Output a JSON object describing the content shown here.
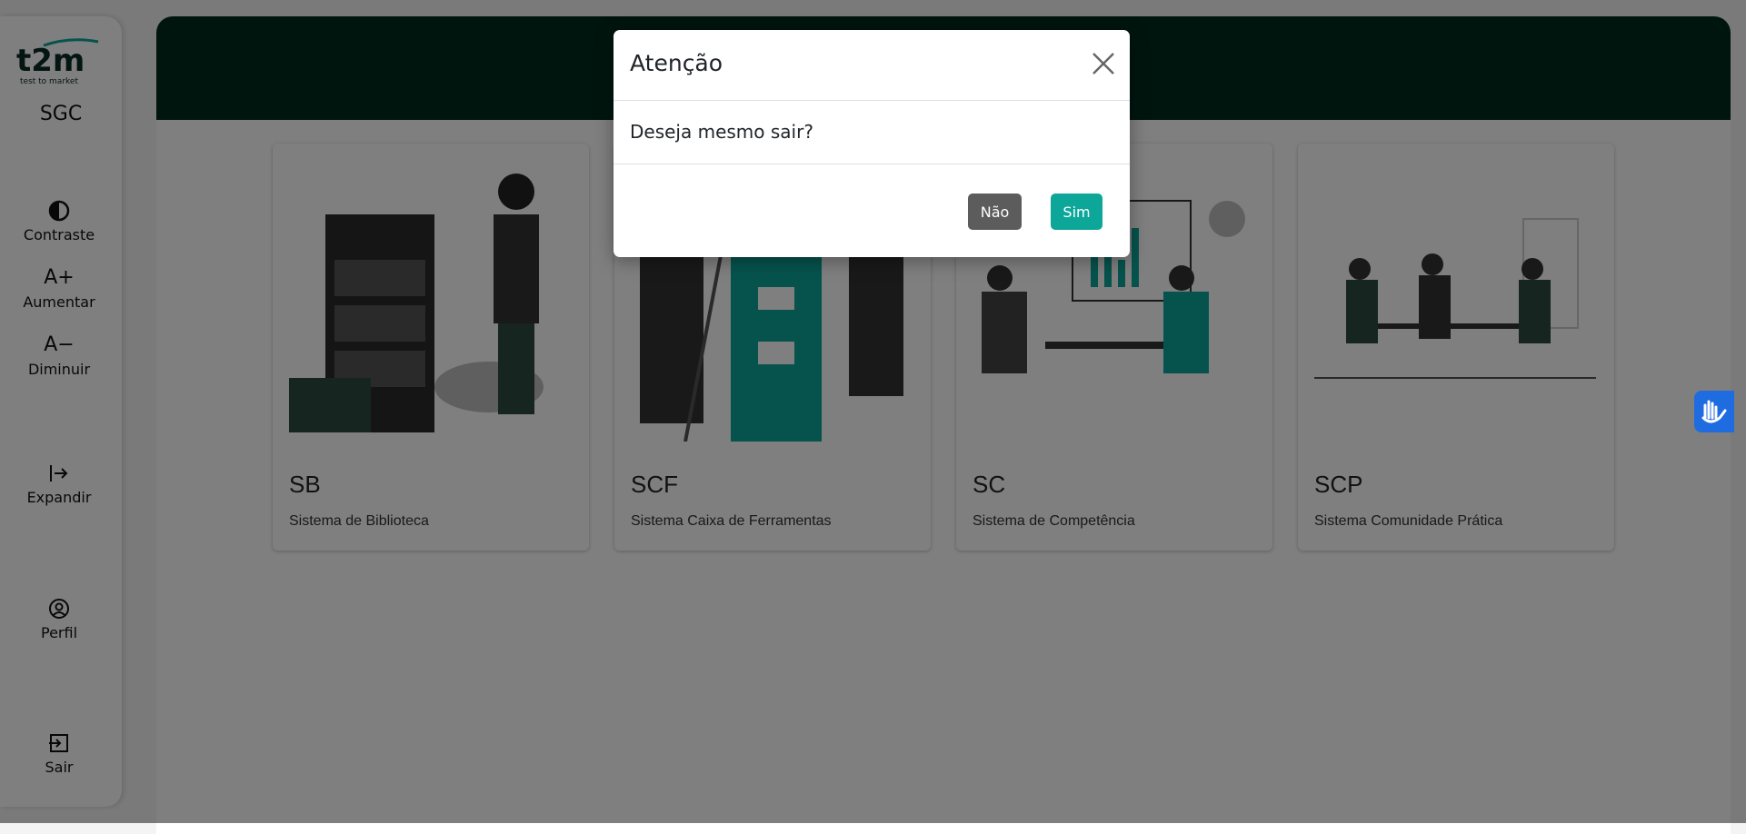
{
  "sidebar": {
    "logo_text": "t2m",
    "logo_tagline": "test to market",
    "app_name": "SGC",
    "items": [
      {
        "label": "Contraste",
        "icon": "contrast-icon",
        "glyph": "◐"
      },
      {
        "label": "Aumentar",
        "icon": "font-increase-icon",
        "glyph": "A+"
      },
      {
        "label": "Diminuir",
        "icon": "font-decrease-icon",
        "glyph": "A−"
      },
      {
        "label": "Expandir",
        "icon": "expand-icon",
        "glyph": "|→"
      },
      {
        "label": "Perfil",
        "icon": "profile-icon",
        "glyph": "◯"
      },
      {
        "label": "Sair",
        "icon": "logout-icon",
        "glyph": "⇥"
      }
    ]
  },
  "systems": [
    {
      "code": "SB",
      "name": "Sistema de Biblioteca"
    },
    {
      "code": "SCF",
      "name": "Sistema Caixa de Ferramentas"
    },
    {
      "code": "SC",
      "name": "Sistema de Competência"
    },
    {
      "code": "SCP",
      "name": "Sistema Comunidade Prática"
    }
  ],
  "modal": {
    "title": "Atenção",
    "message": "Deseja mesmo sair?",
    "no_label": "Não",
    "yes_label": "Sim"
  },
  "colors": {
    "header": "#022a1f",
    "accent": "#0da79a",
    "no_button": "#5c5c5c",
    "accessibility_widget": "#1f6ce0"
  }
}
